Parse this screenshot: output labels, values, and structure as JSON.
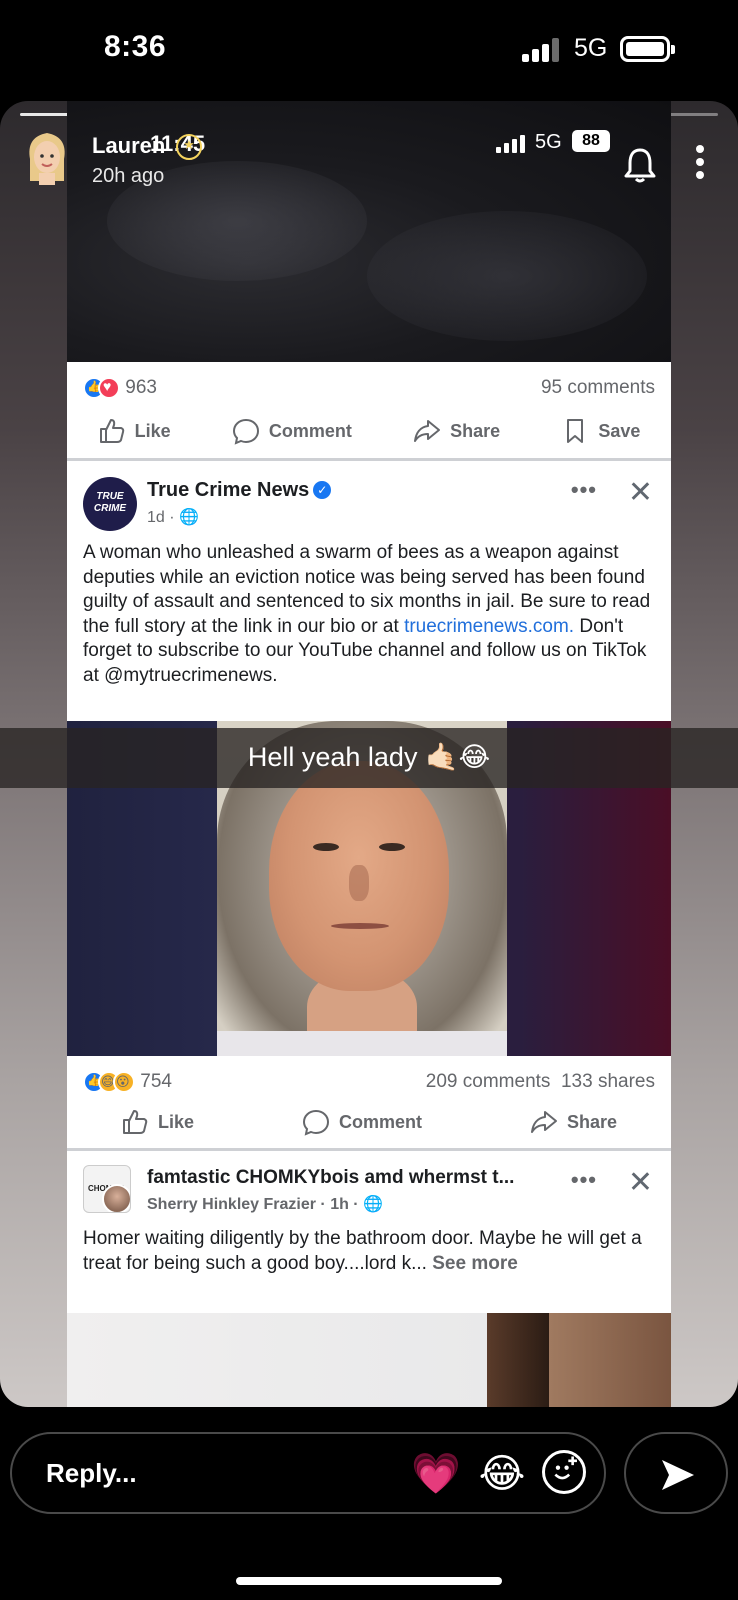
{
  "status_bar": {
    "time": "8:36",
    "network": "5G",
    "signal_bars": 3,
    "signal_total": 4
  },
  "story": {
    "progress_segments": 7,
    "progress_viewed": 4,
    "user_name": "Lauren",
    "time_ago": "20h ago",
    "caption": "Hell yeah lady 🤙🏻😂"
  },
  "inner_status": {
    "time": "11:45",
    "network": "5G",
    "battery": "88"
  },
  "post1_footer": {
    "reaction_count": "963",
    "comments": "95 comments",
    "actions": [
      "Like",
      "Comment",
      "Share",
      "Save"
    ]
  },
  "post2": {
    "logo_line1": "TRUE",
    "logo_line2": "CRIME",
    "page_name": "True Crime News",
    "meta": "1d · ",
    "text_before_link": "A woman who unleashed a swarm of bees as a weapon against deputies while an eviction notice was being served has been found guilty of assault and sentenced to six months in jail. Be sure to read the full story at the link in our bio or at ",
    "link": "truecrimenews.com.",
    "text_after_link": " Don't forget to subscribe to our YouTube channel and follow us on TikTok at @mytruecrimenews.",
    "reaction_count": "754",
    "comments": "209 comments",
    "shares": "133 shares",
    "actions": [
      "Like",
      "Comment",
      "Share"
    ]
  },
  "post3": {
    "group_name": "famtastic CHOMKYbois amd whermst t...",
    "author_meta": "Sherry Hinkley Frazier · 1h · ",
    "logo_text": "CHOMKY",
    "text": "Homer waiting diligently by the bathroom door. Maybe he will get a treat for being such a good boy....lord k... ",
    "see_more": "See more"
  },
  "reply_bar": {
    "placeholder": "Reply..."
  },
  "colors": {
    "facebook_blue": "#1877f2",
    "link_blue": "#216fdb",
    "snap_yellow": "#f4d35e"
  }
}
